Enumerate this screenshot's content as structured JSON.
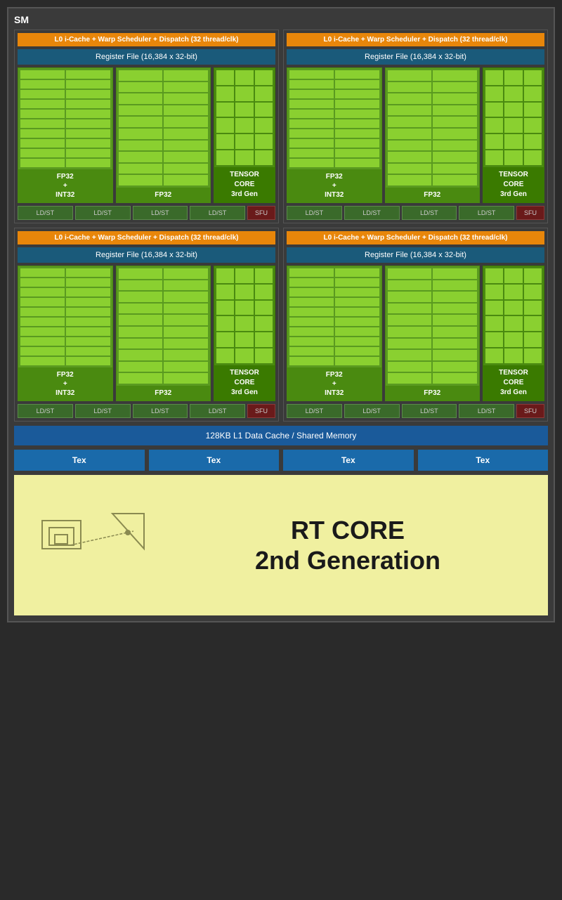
{
  "sm": {
    "label": "SM",
    "quadrants": [
      {
        "id": "q1",
        "l0_cache": "L0 i-Cache + Warp Scheduler + Dispatch (32 thread/clk)",
        "register_file": "Register File (16,384 x 32-bit)",
        "fp32_int32_label": "FP32\n+\nINT32",
        "fp32_label": "FP32",
        "tensor_label": "TENSOR\nCORE\n3rd Gen",
        "ldst_labels": [
          "LD/ST",
          "LD/ST",
          "LD/ST",
          "LD/ST"
        ],
        "sfu_label": "SFU"
      },
      {
        "id": "q2",
        "l0_cache": "L0 i-Cache + Warp Scheduler + Dispatch (32 thread/clk)",
        "register_file": "Register File (16,384 x 32-bit)",
        "fp32_int32_label": "FP32\n+\nINT32",
        "fp32_label": "FP32",
        "tensor_label": "TENSOR\nCORE\n3rd Gen",
        "ldst_labels": [
          "LD/ST",
          "LD/ST",
          "LD/ST",
          "LD/ST"
        ],
        "sfu_label": "SFU"
      },
      {
        "id": "q3",
        "l0_cache": "L0 i-Cache + Warp Scheduler + Dispatch (32 thread/clk)",
        "register_file": "Register File (16,384 x 32-bit)",
        "fp32_int32_label": "FP32\n+\nINT32",
        "fp32_label": "FP32",
        "tensor_label": "TENSOR\nCORE\n3rd Gen",
        "ldst_labels": [
          "LD/ST",
          "LD/ST",
          "LD/ST",
          "LD/ST"
        ],
        "sfu_label": "SFU"
      },
      {
        "id": "q4",
        "l0_cache": "L0 i-Cache + Warp Scheduler + Dispatch (32 thread/clk)",
        "register_file": "Register File (16,384 x 32-bit)",
        "fp32_int32_label": "FP32\n+\nINT32",
        "fp32_label": "FP32",
        "tensor_label": "TENSOR\nCORE\n3rd Gen",
        "ldst_labels": [
          "LD/ST",
          "LD/ST",
          "LD/ST",
          "LD/ST"
        ],
        "sfu_label": "SFU"
      }
    ],
    "l1_cache": "128KB L1 Data Cache / Shared Memory",
    "tex_units": [
      "Tex",
      "Tex",
      "Tex",
      "Tex"
    ],
    "rt_core": {
      "title": "RT CORE",
      "subtitle": "2nd Generation"
    }
  }
}
